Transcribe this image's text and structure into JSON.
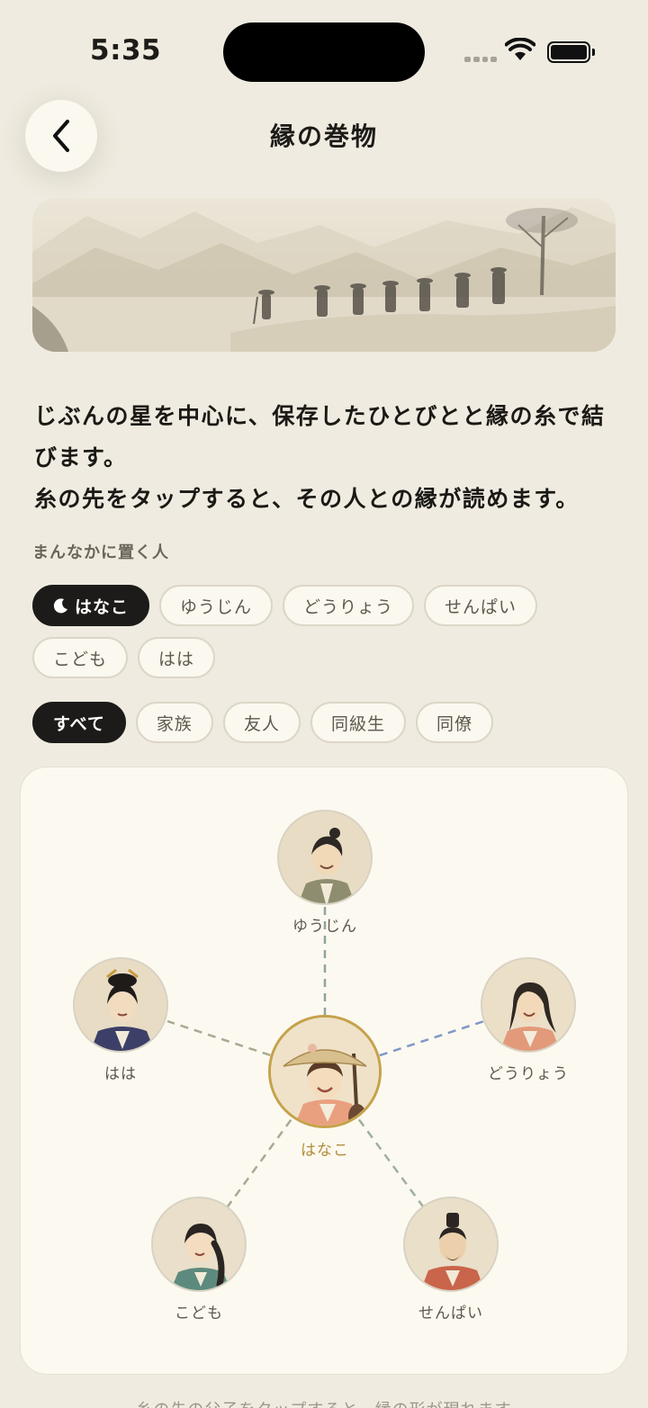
{
  "status_bar": {
    "time": "5:35"
  },
  "header": {
    "title": "縁の巻物"
  },
  "intro": {
    "line1": "じぶんの星を中心に、保存したひとびとと縁の糸で結びます。",
    "line2": "糸の先をタップすると、その人との縁が読めます。"
  },
  "center_picker": {
    "label": "まんなかに置く人",
    "options": [
      "はなこ",
      "ゆうじん",
      "どうりょう",
      "せんぱい",
      "こども",
      "はは"
    ],
    "selected": "はなこ"
  },
  "filters": {
    "options": [
      "すべて",
      "家族",
      "友人",
      "同級生",
      "同僚"
    ],
    "selected": "すべて"
  },
  "graph": {
    "center": {
      "name": "はなこ"
    },
    "nodes": [
      {
        "name": "ゆうじん",
        "line_color": "#8fa3a0"
      },
      {
        "name": "はは",
        "line_color": "#a7aa92"
      },
      {
        "name": "どうりょう",
        "line_color": "#7f98c8"
      },
      {
        "name": "こども",
        "line_color": "#a7aa92"
      },
      {
        "name": "せんぱい",
        "line_color": "#9db0a0"
      }
    ]
  },
  "footer": {
    "hint": "糸の先の父子をタップすると、縁の形が現れます"
  },
  "colors": {
    "background": "#efebe0",
    "accent_gold": "#c5a24a",
    "chip_active": "#1c1b19"
  }
}
